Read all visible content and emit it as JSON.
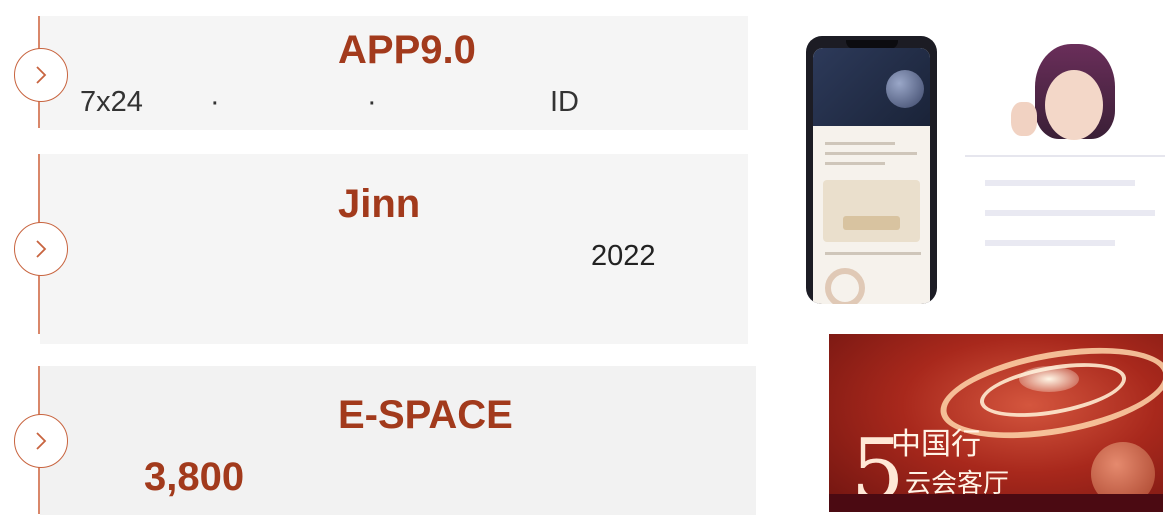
{
  "timeline": {
    "items": [
      {
        "title": "APP9.0",
        "line1_a": "7x24",
        "line1_b": "·",
        "line1_c": "·",
        "line1_d": "ID"
      },
      {
        "title": "Jinn",
        "year": "2022"
      },
      {
        "title": "E-SPACE",
        "figure": "3,800"
      }
    ]
  },
  "icons": {
    "item_arrow": "chevron-right-icon"
  },
  "colors": {
    "accent": "#a23a1c",
    "line": "#d9876a",
    "panel": "#f5f5f5"
  },
  "images": {
    "event_banner": {
      "text_cn": "中国行",
      "text_sub": "云会客厅",
      "numeral": "5"
    }
  }
}
